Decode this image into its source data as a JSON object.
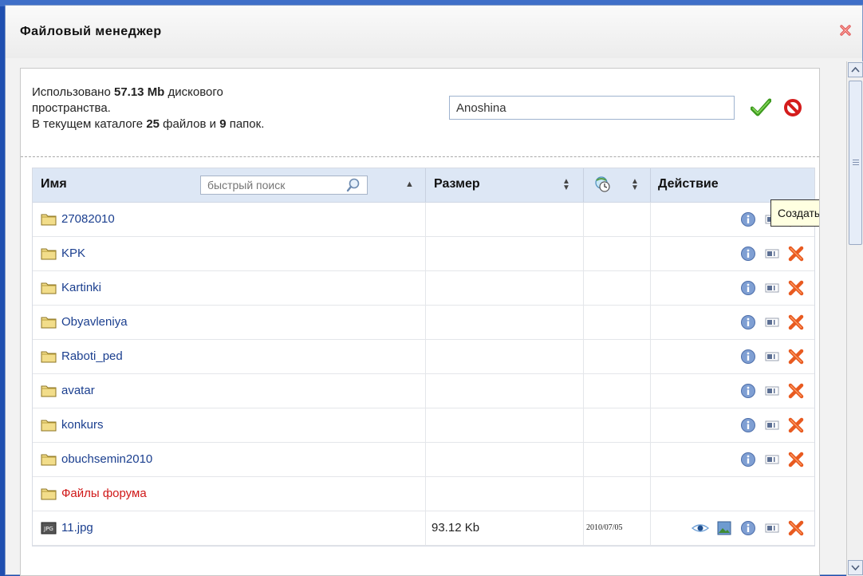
{
  "window": {
    "title": "Файловый менеджер"
  },
  "info": {
    "used_prefix": "Использовано ",
    "used_value": "57.13 Mb",
    "used_suffix": " дискового",
    "used_line2": "пространства.",
    "dir_prefix": "В текущем каталоге ",
    "files_count": "25",
    "files_word": " файлов и ",
    "folders_count": "9",
    "folders_word": " папок."
  },
  "new_folder": {
    "value": "Anoshina"
  },
  "tooltip": {
    "text": "Создать папку"
  },
  "table": {
    "headers": {
      "name": "Имя",
      "size": "Размер",
      "action": "Действие"
    },
    "quick_search": {
      "placeholder": "быстрый поиск"
    },
    "rows": [
      {
        "type": "folder",
        "name": "27082010",
        "size": "",
        "date": ""
      },
      {
        "type": "folder",
        "name": "KPK",
        "size": "",
        "date": ""
      },
      {
        "type": "folder",
        "name": "Kartinki",
        "size": "",
        "date": ""
      },
      {
        "type": "folder",
        "name": "Obyavleniya",
        "size": "",
        "date": ""
      },
      {
        "type": "folder",
        "name": "Raboti_ped",
        "size": "",
        "date": ""
      },
      {
        "type": "folder",
        "name": "avatar",
        "size": "",
        "date": ""
      },
      {
        "type": "folder",
        "name": "konkurs",
        "size": "",
        "date": ""
      },
      {
        "type": "folder",
        "name": "obuchsemin2010",
        "size": "",
        "date": ""
      },
      {
        "type": "folder",
        "name": "Файлы форума",
        "size": "",
        "date": ""
      },
      {
        "type": "jpg",
        "name": "11.jpg",
        "size": "93.12 Kb",
        "date": "2010/07/05"
      }
    ]
  },
  "icons": {
    "close": "close-icon",
    "ok": "checkmark-icon",
    "cancel": "forbidden-icon",
    "folder": "folder-icon",
    "jpg": "jpg-file-icon",
    "info": "info-icon",
    "rename": "rename-icon",
    "delete": "delete-icon",
    "view": "eye-icon",
    "thumbnail": "image-icon",
    "date_header": "clock-icon",
    "search": "magnifier-icon"
  },
  "colors": {
    "folder_link": "#1b3f8f",
    "forum_folder": "#d01818",
    "header_bg": "#dde7f5"
  }
}
